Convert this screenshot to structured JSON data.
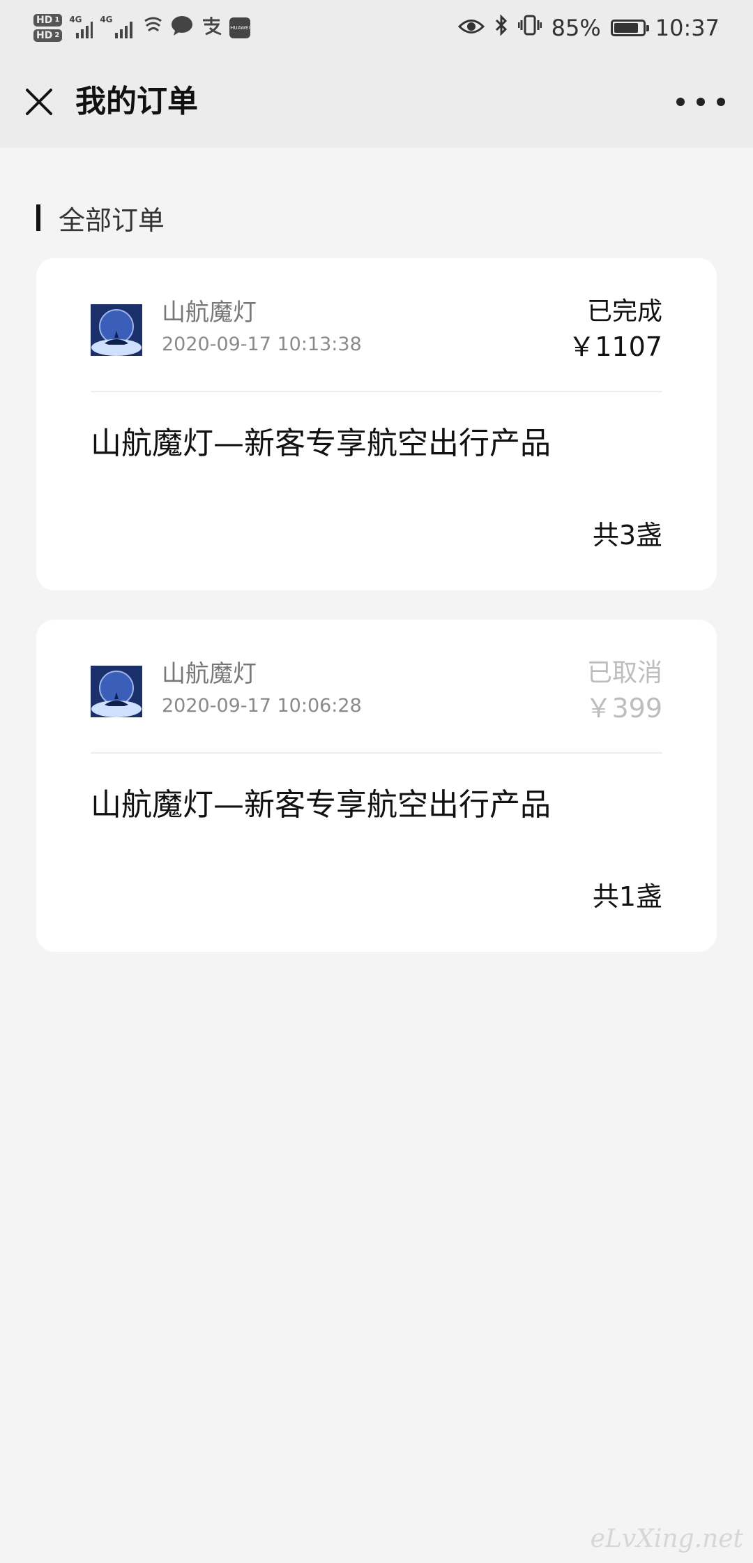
{
  "status_bar": {
    "sim1": "HD",
    "sim1_index": "1",
    "sim2": "HD",
    "sim2_index": "2",
    "network1": "4G",
    "network2": "4G",
    "app_badge": "HUAWEI",
    "battery_percent": "85%",
    "battery_level": 0.85,
    "time": "10:37"
  },
  "nav": {
    "title": "我的订单"
  },
  "section": {
    "title": "全部订单"
  },
  "orders": [
    {
      "shop_name": "山航魔灯",
      "time": "2020-09-17 10:13:38",
      "status": "已完成",
      "price": "￥1107",
      "product": "山航魔灯—新客专享航空出行产品",
      "count": "共3盏"
    },
    {
      "shop_name": "山航魔灯",
      "time": "2020-09-17 10:06:28",
      "status": "已取消",
      "price": "￥399",
      "product": "山航魔灯—新客专享航空出行产品",
      "count": "共1盏"
    }
  ],
  "watermark": "eLvXing.net",
  "colors": {
    "background": "#f4f4f4",
    "header": "#ececec",
    "card": "#ffffff",
    "text_primary": "#111111",
    "text_secondary": "#777777",
    "cancelled": "#bdbdbd"
  }
}
